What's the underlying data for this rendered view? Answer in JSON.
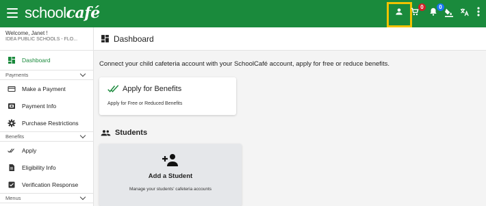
{
  "app": {
    "logo_light": "school",
    "logo_bold": "café"
  },
  "header": {
    "icons": [
      {
        "name": "user-icon"
      },
      {
        "name": "cart-icon",
        "badge": "0"
      },
      {
        "name": "bell-icon",
        "badge": "0"
      },
      {
        "name": "paint-bucket-icon"
      },
      {
        "name": "translate-icon"
      },
      {
        "name": "more-vert-icon"
      }
    ],
    "colors": {
      "bar": "#1a8a3c",
      "highlight": "#f2c200",
      "badge_red": "#d21f26",
      "badge_blue": "#1877f2"
    }
  },
  "sidebar": {
    "welcome": "Welcome, Janet !",
    "district": "IDEA PUBLIC SCHOOLS - FLO...",
    "dashboard_label": "Dashboard",
    "sections": {
      "payments": "Payments",
      "benefits": "Benefits",
      "menus": "Menus"
    },
    "items": {
      "make_payment": "Make a Payment",
      "payment_info": "Payment Info",
      "purchase_restrictions": "Purchase Restrictions",
      "apply": "Apply",
      "eligibility_info": "Eligibility Info",
      "verification_response": "Verification Response"
    }
  },
  "main": {
    "page_title": "Dashboard",
    "intro": "Connect your child cafeteria account with your SchoolCafé account, apply for free or reduce benefits.",
    "benefits_card": {
      "title": "Apply for Benefits",
      "subtitle": "Apply for Free or Reduced Benefits"
    },
    "students_heading": "Students",
    "add_student_card": {
      "title": "Add a Student",
      "subtitle": "Manage your students' cafeteria accounts"
    }
  }
}
